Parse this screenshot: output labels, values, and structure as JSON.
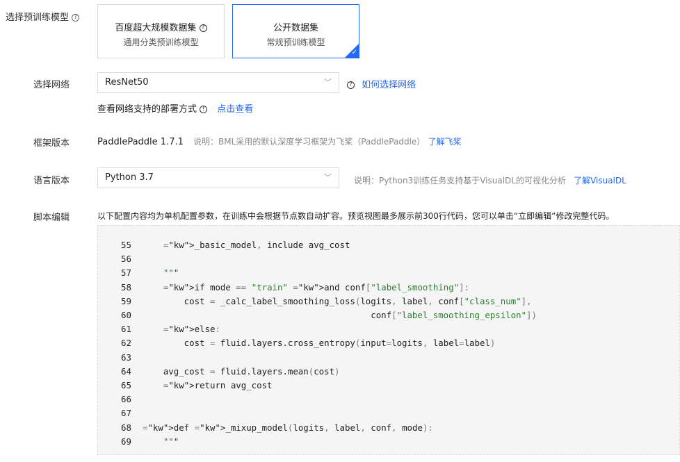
{
  "pretrain": {
    "label": "选择预训练模型",
    "help_icon": "?",
    "cards": [
      {
        "title": "百度超大规模数据集",
        "subtitle": "通用分类预训练模型",
        "selected": false
      },
      {
        "title": "公开数据集",
        "subtitle": "常规预训练模型",
        "selected": true
      }
    ]
  },
  "network": {
    "label": "选择网络",
    "value": "ResNet50",
    "help_link": "如何选择网络",
    "deploy_text": "查看网络支持的部署方式",
    "deploy_link": "点击查看"
  },
  "framework": {
    "label": "框架版本",
    "value": "PaddlePaddle 1.7.1",
    "note": "说明：BML采用的默认深度学习框架为飞桨（PaddlePaddle）",
    "link": "了解飞桨"
  },
  "language": {
    "label": "语言版本",
    "value": "Python 3.7",
    "note": "说明：Python3训练任务支持基于VisualDL的可视化分析",
    "link": "了解VisualDL"
  },
  "script": {
    "label": "脚本编辑",
    "description": "以下配置内容均为单机配置参数，在训练中会根据节点数自动扩容。预览视图最多展示前300行代码，您可以单击“立即编辑”修改完整代码。",
    "lines": [
      {
        "n": "55",
        "code": "    _basic_model, include avg_cost"
      },
      {
        "n": "56",
        "code": ""
      },
      {
        "n": "57",
        "code": "    \"\"\""
      },
      {
        "n": "58",
        "code": "    if mode == \"train\" and conf[\"label_smoothing\"]:"
      },
      {
        "n": "59",
        "code": "        cost = _calc_label_smoothing_loss(logits, label, conf[\"class_num\"],"
      },
      {
        "n": "60",
        "code": "                                            conf[\"label_smoothing_epsilon\"])"
      },
      {
        "n": "61",
        "code": "    else:"
      },
      {
        "n": "62",
        "code": "        cost = fluid.layers.cross_entropy(input=logits, label=label)"
      },
      {
        "n": "63",
        "code": ""
      },
      {
        "n": "64",
        "code": "    avg_cost = fluid.layers.mean(cost)"
      },
      {
        "n": "65",
        "code": "    return avg_cost"
      },
      {
        "n": "66",
        "code": ""
      },
      {
        "n": "67",
        "code": ""
      },
      {
        "n": "68",
        "code": "def _mixup_model(logits, label, conf, mode):"
      },
      {
        "n": "69",
        "code": "    \"\"\""
      }
    ]
  },
  "colors": {
    "accent": "#2468f2",
    "code_bg": "#f5f5f5",
    "code_keyword": "#2e7d32"
  }
}
